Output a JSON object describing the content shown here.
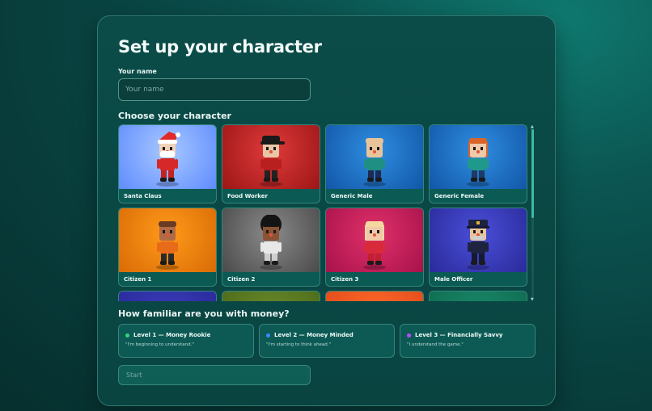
{
  "title": "Set up your character",
  "name_field": {
    "label": "Your name",
    "placeholder": "Your name",
    "value": ""
  },
  "choose_label": "Choose your character",
  "characters": [
    {
      "name": "Santa Claus",
      "bg": [
        "#a8c8ff",
        "#5f8cff"
      ],
      "skin": "#f2d2b6",
      "hair": "#ffffff",
      "hat": "#e02a2a",
      "shirt": "#d62828",
      "pants": "#c42222"
    },
    {
      "name": "Food Worker",
      "bg": [
        "#e03a3a",
        "#9c1616"
      ],
      "skin": "#e9c7a6",
      "hair": "#222222",
      "hat": "#1a1a1a",
      "shirt": "#b81f1f",
      "pants": "#222222"
    },
    {
      "name": "Generic Male",
      "bg": [
        "#2f8ee0",
        "#1256a8"
      ],
      "skin": "#e9c49a",
      "hair": "#e9c49a",
      "hat": "",
      "shirt": "#1f8f84",
      "pants": "#1d2a55"
    },
    {
      "name": "Generic Female",
      "bg": [
        "#2f8ee0",
        "#1256a8"
      ],
      "skin": "#f0c9a8",
      "hair": "#d9642a",
      "hat": "",
      "shirt": "#1f9a8a",
      "pants": "#1d3a66"
    },
    {
      "name": "Citizen 1",
      "bg": [
        "#ff9a1a",
        "#d96b05"
      ],
      "skin": "#b06a45",
      "hair": "#6b3a22",
      "hat": "",
      "shirt": "#e86b1a",
      "pants": "#2a2a2a"
    },
    {
      "name": "Citizen 2",
      "bg": [
        "#8a8a8a",
        "#4a4a4a"
      ],
      "skin": "#8a5434",
      "hair": "#141414",
      "hat": "",
      "shirt": "#e8e8e8",
      "pants": "#cfcfcf"
    },
    {
      "name": "Citizen 3",
      "bg": [
        "#e0306a",
        "#a8124a"
      ],
      "skin": "#f0c9a8",
      "hair": "#f3d9a0",
      "hat": "",
      "shirt": "#d82a3a",
      "pants": "#c21f2f"
    },
    {
      "name": "Male Officer",
      "bg": [
        "#4a4fd8",
        "#2a2a9a"
      ],
      "skin": "#e9c49a",
      "hair": "#9a9a9a",
      "hat": "#1e2440",
      "shirt": "#1e2440",
      "pants": "#141a30"
    },
    {
      "name": "",
      "bg": [
        "#3a3ab8",
        "#2a2a9a"
      ]
    },
    {
      "name": "",
      "bg": [
        "#6a8a2a",
        "#4a6a1a"
      ]
    },
    {
      "name": "",
      "bg": [
        "#ff6a2a",
        "#e04a1a"
      ]
    },
    {
      "name": "",
      "bg": [
        "#1a8a6a",
        "#0f6a50"
      ]
    }
  ],
  "familiar_label": "How familiar are you with money?",
  "levels": [
    {
      "title": "Level 1 — Money Rookie",
      "subtitle": "\"I'm beginning to understand.\"",
      "color": "#2fd67a"
    },
    {
      "title": "Level 2 — Money Minded",
      "subtitle": "\"I'm starting to think ahead.\"",
      "color": "#3a8aff"
    },
    {
      "title": "Level 3 — Financially Savvy",
      "subtitle": "\"I understand the game.\"",
      "color": "#b84aff"
    }
  ],
  "start_button": "Start"
}
